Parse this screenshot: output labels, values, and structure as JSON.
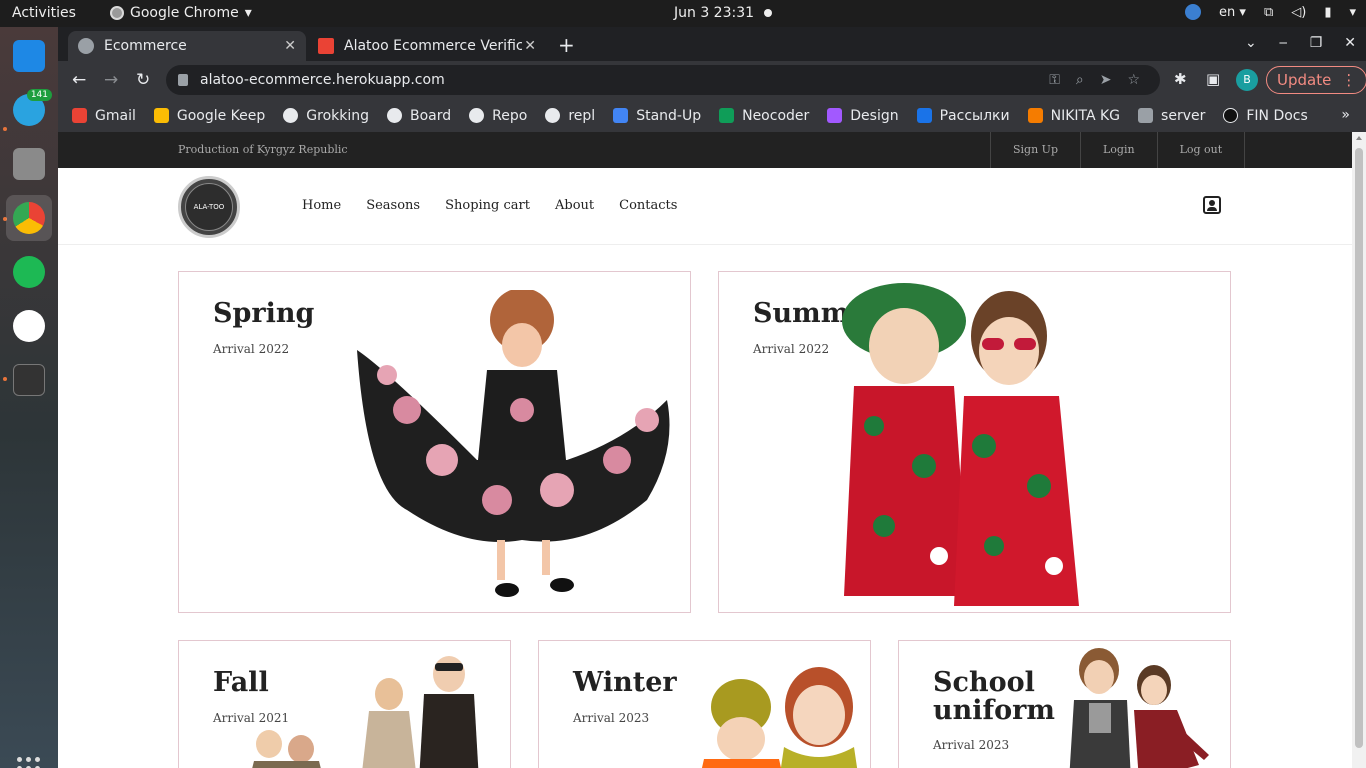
{
  "os": {
    "activities": "Activities",
    "app_name": "Google Chrome",
    "clock": "Jun 3  23:31",
    "lang": "en"
  },
  "dock": {
    "telegram_badge": "141"
  },
  "browser": {
    "tabs": [
      {
        "title": "Ecommerce"
      },
      {
        "title": "Alatoo Ecommerce Verific"
      }
    ],
    "url": "alatoo-ecommerce.herokuapp.com",
    "profile_initial": "B",
    "update_label": "Update",
    "bookmarks": [
      {
        "label": "Gmail",
        "color": "#ea4335"
      },
      {
        "label": "Google Keep",
        "color": "#fbbc04"
      },
      {
        "label": "Grokking",
        "color": "#e8eaed"
      },
      {
        "label": "Board",
        "color": "#e8eaed"
      },
      {
        "label": "Repo",
        "color": "#e8eaed"
      },
      {
        "label": "repl",
        "color": "#e8eaed"
      },
      {
        "label": "Stand-Up",
        "color": "#4285f4"
      },
      {
        "label": "Neocoder",
        "color": "#0f9d58"
      },
      {
        "label": "Design",
        "color": "#a259ff"
      },
      {
        "label": "Рассылки",
        "color": "#1a73e8"
      },
      {
        "label": "NIKITA KG",
        "color": "#f57c00"
      },
      {
        "label": "server",
        "color": "#9aa0a6"
      },
      {
        "label": "FIN Docs",
        "color": "#e8eaed"
      }
    ]
  },
  "site": {
    "production": "Production of Kyrgyz Republic",
    "auth_links": [
      "Sign Up",
      "Login",
      "Log out"
    ],
    "logo_text": "ALA-TOO",
    "nav": [
      "Home",
      "Seasons",
      "Shoping cart",
      "About",
      "Contacts"
    ],
    "cards": [
      {
        "title": "Spring",
        "subtitle": "Arrival 2022"
      },
      {
        "title": "Summer",
        "subtitle": "Arrival 2022"
      },
      {
        "title": "Fall",
        "subtitle": "Arrival 2021"
      },
      {
        "title": "Winter",
        "subtitle": "Arrival 2023"
      },
      {
        "title": "School uniform",
        "subtitle": "Arrival 2023"
      }
    ]
  }
}
